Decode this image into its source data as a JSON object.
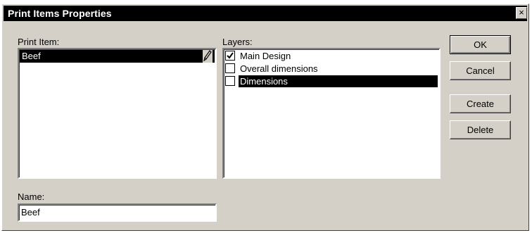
{
  "window": {
    "title": "Print Items Properties",
    "close_glyph": "×"
  },
  "print_items": {
    "label": "Print Item:",
    "items": [
      {
        "label": "Beef",
        "selected": true,
        "edit_icon": "pencil-icon"
      }
    ]
  },
  "layers": {
    "label": "Layers:",
    "items": [
      {
        "label": "Main Design",
        "checked": true,
        "selected": false
      },
      {
        "label": "Overall dimensions",
        "checked": false,
        "selected": false
      },
      {
        "label": "Dimensions",
        "checked": false,
        "selected": true
      }
    ]
  },
  "name": {
    "label": "Name:",
    "value": "Beef"
  },
  "buttons": {
    "ok": "OK",
    "cancel": "Cancel",
    "create": "Create",
    "delete": "Delete"
  },
  "colors": {
    "face": "#d4d0c8",
    "selection": "#000000",
    "title_bar": "#000000"
  }
}
